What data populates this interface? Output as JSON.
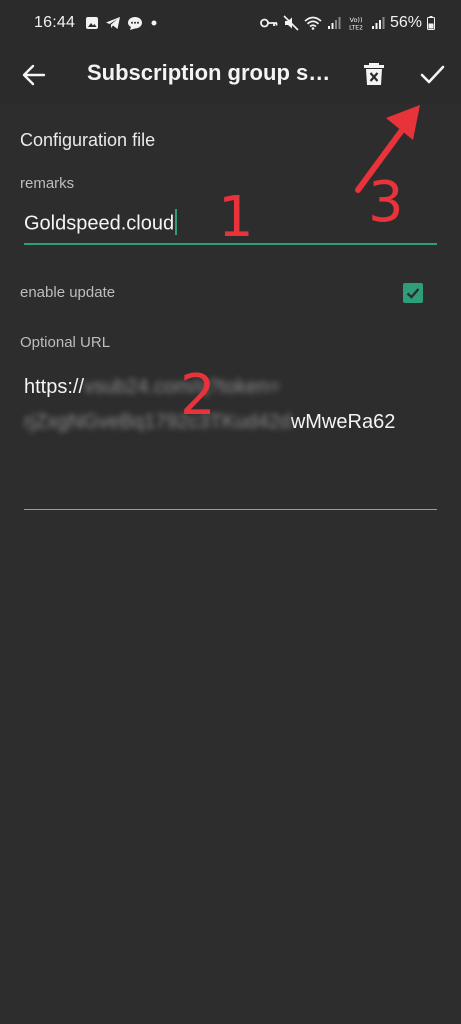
{
  "status_bar": {
    "time": "16:44",
    "battery": "56%",
    "left_icons": [
      "gallery-icon",
      "telegram-icon",
      "chat-icon",
      "dot-icon"
    ],
    "right_icons": [
      "key-icon",
      "mute-icon",
      "wifi-icon",
      "signal-icon",
      "volte-icon",
      "signal-icon",
      "battery-icon"
    ]
  },
  "appbar": {
    "title": "Subscription group settings",
    "back_icon": "arrow-left-icon",
    "delete_icon": "delete-icon",
    "confirm_icon": "check-icon"
  },
  "form": {
    "section_title": "Configuration file",
    "remarks_label": "remarks",
    "remarks_value": "Goldspeed.cloud",
    "enable_update_label": "enable update",
    "enable_update_checked": true,
    "url_label": "Optional URL",
    "url_visible_start": "https://",
    "url_blurred_1": "vsub24.com/q?token=",
    "url_blurred_2": "rjZxgNGveBq1792c3TKud42d",
    "url_visible_end": "wMweRa62"
  },
  "annotations": [
    "1",
    "2",
    "3"
  ],
  "colors": {
    "background": "#2d2d2d",
    "accent": "#2e9e7a",
    "annotation": "#e8333a"
  }
}
